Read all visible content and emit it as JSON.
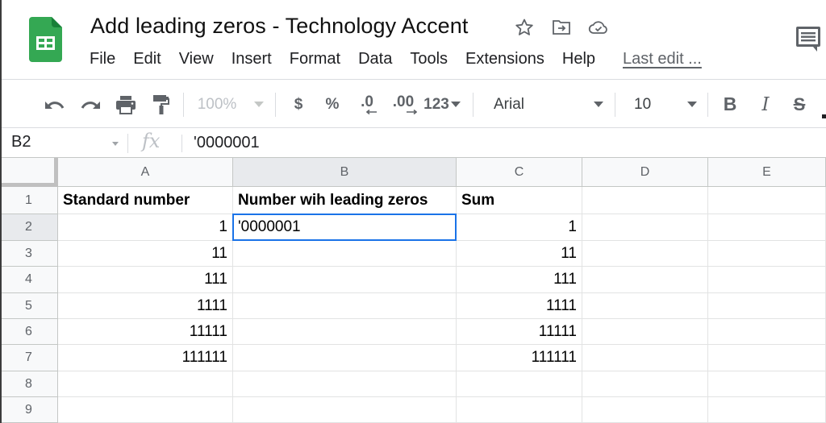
{
  "app": {
    "title": "Add leading zeros - Technology Accent",
    "title_icons": [
      "star-icon",
      "move-to-folder-icon",
      "cloud-saved-icon"
    ],
    "menu": [
      "File",
      "Edit",
      "View",
      "Insert",
      "Format",
      "Data",
      "Tools",
      "Extensions",
      "Help"
    ],
    "last_edit": "Last edit ...",
    "brand_color": "#34a853"
  },
  "toolbar": {
    "undo": "undo-icon",
    "redo": "redo-icon",
    "print": "print-icon",
    "paint_format": "paint-format-icon",
    "zoom": "100%",
    "currency": "$",
    "percent": "%",
    "decrease_decimal": ".0",
    "increase_decimal": ".00",
    "more_formats": "123",
    "font": "Arial",
    "font_size": "10",
    "bold": "B",
    "italic": "I",
    "strikethrough": "S"
  },
  "formula_bar": {
    "name_box": "B2",
    "fx_label": "fx",
    "value": "'0000001"
  },
  "sheet": {
    "selected_cell": "B2",
    "selection_color": "#1a73e8",
    "columns": [
      "A",
      "B",
      "C",
      "D",
      "E"
    ],
    "rows": [
      {
        "num": "1",
        "cells": [
          "Standard number",
          "Number wih leading zeros",
          "Sum",
          "",
          ""
        ]
      },
      {
        "num": "2",
        "cells": [
          "1",
          "'0000001",
          "1",
          "",
          ""
        ]
      },
      {
        "num": "3",
        "cells": [
          "11",
          "",
          "11",
          "",
          ""
        ]
      },
      {
        "num": "4",
        "cells": [
          "111",
          "",
          "111",
          "",
          ""
        ]
      },
      {
        "num": "5",
        "cells": [
          "1111",
          "",
          "1111",
          "",
          ""
        ]
      },
      {
        "num": "6",
        "cells": [
          "11111",
          "",
          "11111",
          "",
          ""
        ]
      },
      {
        "num": "7",
        "cells": [
          "111111",
          "",
          "111111",
          "",
          ""
        ]
      },
      {
        "num": "8",
        "cells": [
          "",
          "",
          "",
          "",
          ""
        ]
      },
      {
        "num": "9",
        "cells": [
          "",
          "",
          "",
          "",
          ""
        ]
      }
    ]
  }
}
